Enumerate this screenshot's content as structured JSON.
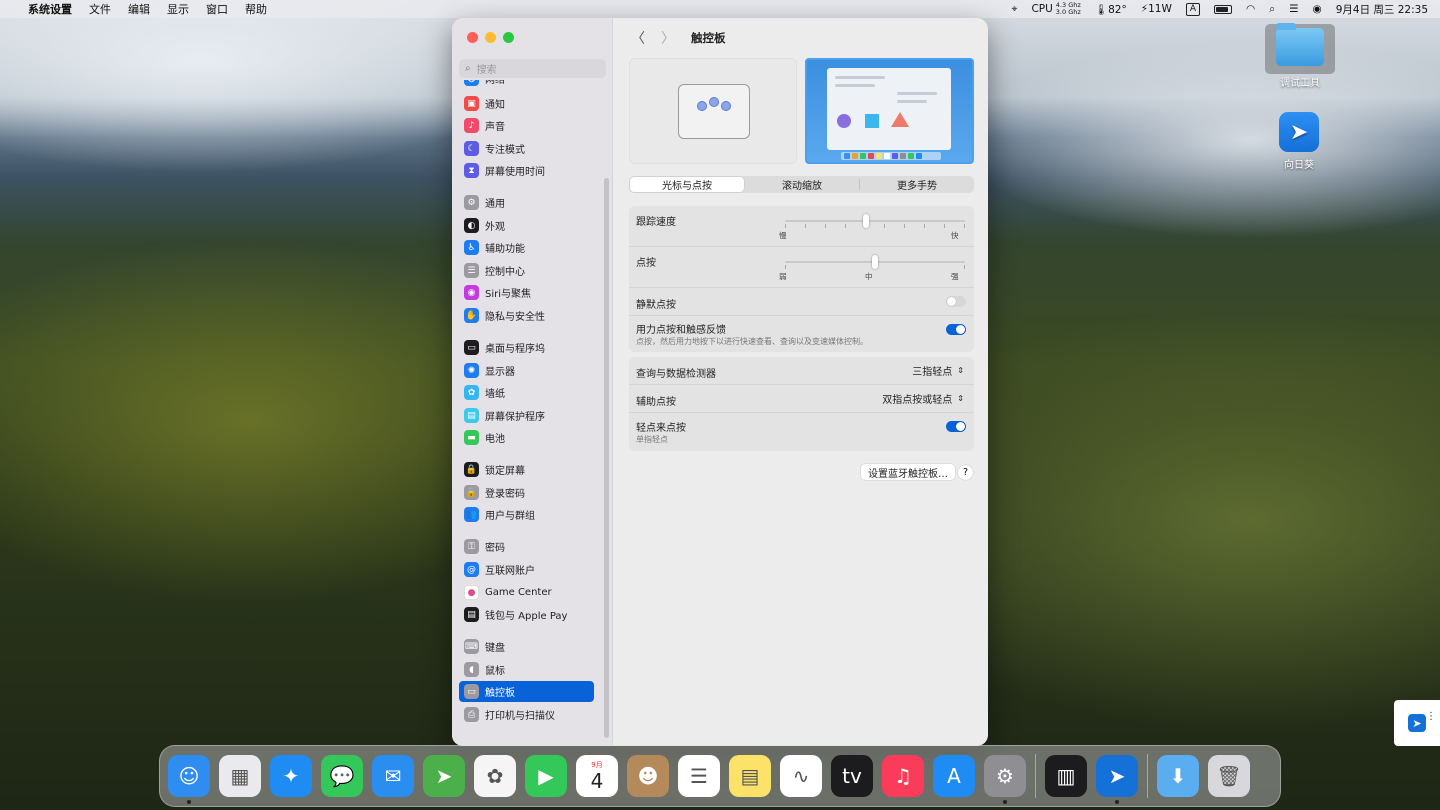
{
  "menubar": {
    "app_name": "系统设置",
    "menus": [
      "文件",
      "编辑",
      "显示",
      "窗口",
      "帮助"
    ],
    "cpu_label": "CPU",
    "cpu_freq_1": "4.3 Ghz",
    "cpu_freq_2": "3.0 Ghz",
    "temperature": "82°",
    "power": "11W",
    "input_method": "A",
    "datetime": "9月4日 周三  22:35"
  },
  "desktop": {
    "icons": [
      {
        "label": "调试工具",
        "icon": "folder-icon"
      },
      {
        "label": "向日葵",
        "icon": "sunflower-app-icon"
      }
    ]
  },
  "sidebar": {
    "search_placeholder": "搜索",
    "items": [
      {
        "label": "网络",
        "color": "#1e7cf2",
        "glyph": "◍"
      },
      {
        "label": "通知",
        "color": "#f04a4a",
        "glyph": "▣"
      },
      {
        "label": "声音",
        "color": "#f04a6a",
        "glyph": "♪"
      },
      {
        "label": "专注模式",
        "color": "#5e5ce6",
        "glyph": "☾"
      },
      {
        "label": "屏幕使用时间",
        "color": "#5e5ce6",
        "glyph": "⧗"
      },
      {
        "label": "通用",
        "color": "#9a9aa0",
        "glyph": "⚙"
      },
      {
        "label": "外观",
        "color": "#1c1c1e",
        "glyph": "◐"
      },
      {
        "label": "辅助功能",
        "color": "#1e7cf2",
        "glyph": "♿"
      },
      {
        "label": "控制中心",
        "color": "#9a9aa0",
        "glyph": "☰"
      },
      {
        "label": "Siri与聚焦",
        "color": "#c23ae0",
        "glyph": "◉"
      },
      {
        "label": "隐私与安全性",
        "color": "#1e7cf2",
        "glyph": "✋"
      },
      {
        "label": "桌面与程序坞",
        "color": "#1c1c1e",
        "glyph": "▭"
      },
      {
        "label": "显示器",
        "color": "#1e7cf2",
        "glyph": "✺"
      },
      {
        "label": "墙纸",
        "color": "#35b6f0",
        "glyph": "✿"
      },
      {
        "label": "屏幕保护程序",
        "color": "#3dc9e8",
        "glyph": "▤"
      },
      {
        "label": "电池",
        "color": "#34c759",
        "glyph": "▬"
      },
      {
        "label": "锁定屏幕",
        "color": "#1c1c1e",
        "glyph": "🔒"
      },
      {
        "label": "登录密码",
        "color": "#9a9aa0",
        "glyph": "🔒"
      },
      {
        "label": "用户与群组",
        "color": "#1e7cf2",
        "glyph": "👥"
      },
      {
        "label": "密码",
        "color": "#9a9aa0",
        "glyph": "⚿"
      },
      {
        "label": "互联网账户",
        "color": "#1e7cf2",
        "glyph": "@"
      },
      {
        "label": "Game Center",
        "color": "#ffffff",
        "glyph": "●"
      },
      {
        "label": "钱包与 Apple Pay",
        "color": "#1c1c1e",
        "glyph": "▤"
      },
      {
        "label": "键盘",
        "color": "#9a9aa0",
        "glyph": "⌨"
      },
      {
        "label": "鼠标",
        "color": "#9a9aa0",
        "glyph": "◖"
      },
      {
        "label": "触控板",
        "color": "#9a9aa0",
        "glyph": "▭"
      },
      {
        "label": "打印机与扫描仪",
        "color": "#9a9aa0",
        "glyph": "⎙"
      }
    ]
  },
  "main": {
    "title": "触控板",
    "tabs": [
      "光标与点按",
      "滚动缩放",
      "更多手势"
    ],
    "tracking_speed": {
      "label": "跟踪速度",
      "min_label": "慢",
      "max_label": "快",
      "value_fraction": 0.45
    },
    "click": {
      "label": "点按",
      "min_label": "弱",
      "mid_label": "中",
      "max_label": "强",
      "value_fraction": 0.5
    },
    "silent_click": {
      "label": "静默点按",
      "on": false
    },
    "force_click": {
      "label": "用力点按和触感反馈",
      "description": "点按，然后用力地按下以进行快速查看、查询以及变速媒体控制。",
      "on": true
    },
    "lookup": {
      "label": "查询与数据检测器",
      "value": "三指轻点"
    },
    "secondary_click": {
      "label": "辅助点按",
      "value": "双指点按或轻点"
    },
    "tap_to_click": {
      "label": "轻点来点按",
      "description": "单指轻点",
      "on": true
    },
    "bluetooth_button": "设置蓝牙触控板…",
    "help_button": "?"
  },
  "dock": {
    "calendar_month": "9月",
    "calendar_day": "4",
    "apps": [
      {
        "name": "finder-icon",
        "color": "#2f8cf0",
        "glyph": "☺",
        "running": true
      },
      {
        "name": "launchpad-icon",
        "color": "#e9e9ee",
        "glyph": "▦",
        "running": false
      },
      {
        "name": "safari-icon",
        "color": "#1e8cf2",
        "glyph": "✦",
        "running": false
      },
      {
        "name": "messages-icon",
        "color": "#34c759",
        "glyph": "💬",
        "running": false
      },
      {
        "name": "mail-icon",
        "color": "#2a8ef0",
        "glyph": "✉",
        "running": false
      },
      {
        "name": "maps-icon",
        "color": "#4cb04a",
        "glyph": "➤",
        "running": false
      },
      {
        "name": "photos-icon",
        "color": "#f5f5f5",
        "glyph": "✿",
        "running": false
      },
      {
        "name": "facetime-icon",
        "color": "#34c759",
        "glyph": "▶",
        "running": false
      },
      {
        "name": "calendar-icon",
        "color": "#ffffff",
        "glyph": "",
        "running": false
      },
      {
        "name": "contacts-icon",
        "color": "#b58a5a",
        "glyph": "☻",
        "running": false
      },
      {
        "name": "reminders-icon",
        "color": "#ffffff",
        "glyph": "☰",
        "running": false
      },
      {
        "name": "notes-icon",
        "color": "#fde26a",
        "glyph": "▤",
        "running": false
      },
      {
        "name": "freeform-icon",
        "color": "#ffffff",
        "glyph": "∿",
        "running": false
      },
      {
        "name": "apple-tv-icon",
        "color": "#1c1c1e",
        "glyph": "tv",
        "running": false
      },
      {
        "name": "music-icon",
        "color": "#fa3c5a",
        "glyph": "♫",
        "running": false
      },
      {
        "name": "app-store-icon",
        "color": "#1e8cf2",
        "glyph": "A",
        "running": false
      },
      {
        "name": "system-settings-icon",
        "color": "#8e8e93",
        "glyph": "⚙",
        "running": true
      },
      {
        "name": "activity-monitor-icon",
        "color": "#1c1c1e",
        "glyph": "▥",
        "running": false
      },
      {
        "name": "sunflower-icon",
        "color": "#1570d8",
        "glyph": "➤",
        "running": true
      },
      {
        "name": "downloads-folder-icon",
        "color": "#5aaef0",
        "glyph": "⬇",
        "running": false
      },
      {
        "name": "trash-icon",
        "color": "#d8d8dc",
        "glyph": "🗑",
        "running": false
      }
    ]
  }
}
